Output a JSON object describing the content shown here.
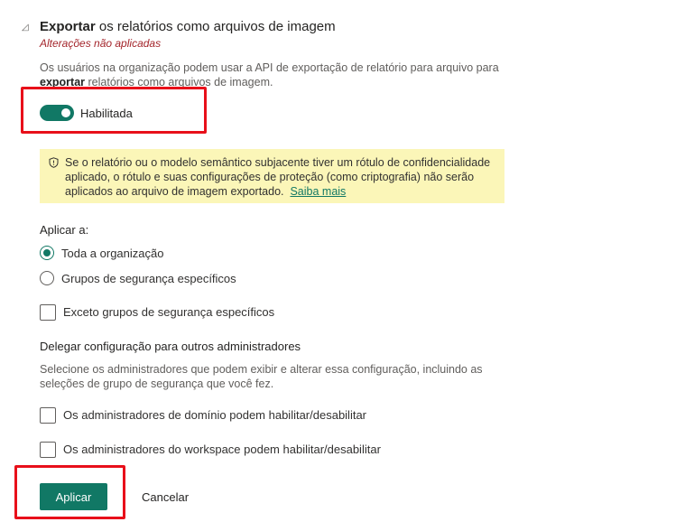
{
  "section": {
    "caret_icon": "collapse-caret-icon",
    "title_bold": "Exportar",
    "title_rest": " os relatórios como arquivos de imagem",
    "status": "Alterações não aplicadas",
    "description_prefix": "Os usuários na organização podem usar a API de exportação de relatório para arquivo para ",
    "description_bold": "exportar",
    "description_suffix": " relatórios como arquivos de imagem."
  },
  "toggle": {
    "enabled": true,
    "label": "Habilitada",
    "accent": "#117865"
  },
  "warning": {
    "icon": "shield-icon",
    "text": "Se o relatório ou o modelo semântico subjacente tiver um rótulo de confidencialidade aplicado, o rótulo e suas configurações de proteção (como criptografia) não serão aplicados ao arquivo de imagem exportado.",
    "link": "Saiba mais",
    "background": "#fbf6b8"
  },
  "apply_to": {
    "label": "Aplicar a:",
    "options": [
      {
        "label": "Toda a organização",
        "selected": true
      },
      {
        "label": "Grupos de segurança específicos",
        "selected": false
      }
    ],
    "except_checkbox": {
      "label": "Exceto grupos de segurança específicos",
      "checked": false
    }
  },
  "delegate": {
    "title": "Delegar configuração para outros administradores",
    "description": "Selecione os administradores que podem exibir e alterar essa configuração, incluindo as seleções de grupo de segurança que você fez.",
    "checkboxes": [
      {
        "label": "Os administradores de domínio podem habilitar/desabilitar",
        "checked": false
      },
      {
        "label": "Os administradores do workspace podem habilitar/desabilitar",
        "checked": false
      }
    ]
  },
  "actions": {
    "apply": "Aplicar",
    "cancel": "Cancelar"
  },
  "highlight_color": "#e8101a"
}
